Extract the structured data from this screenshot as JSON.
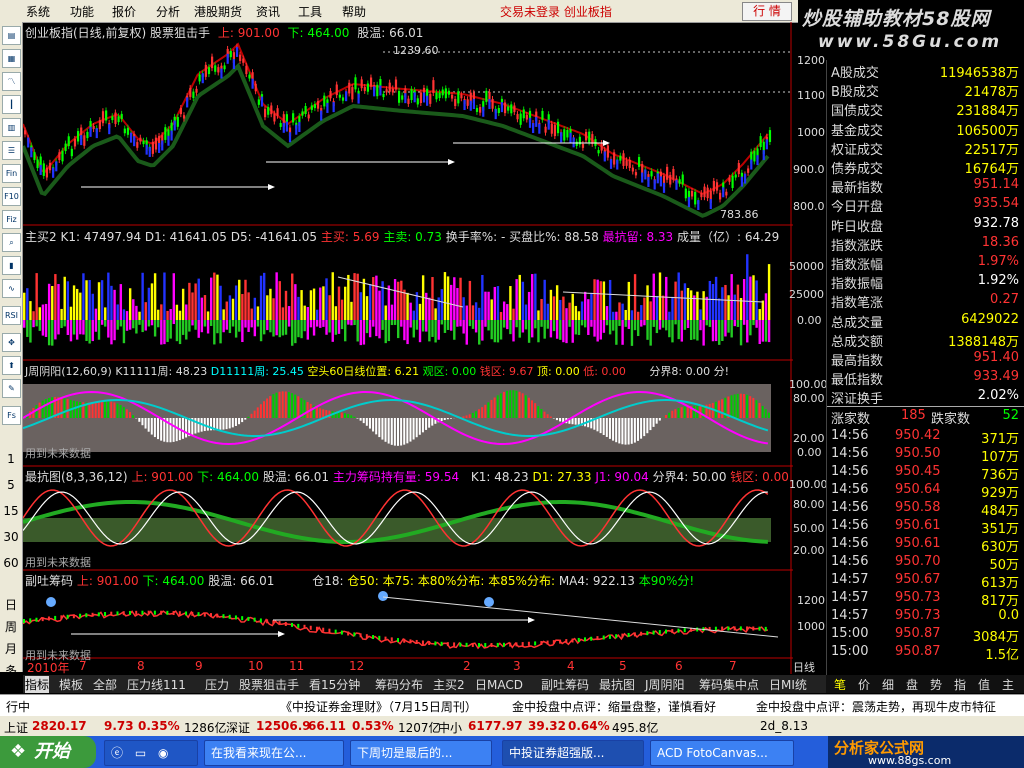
{
  "menu": {
    "items": [
      "系统",
      "功能",
      "报价",
      "分析",
      "港股期货",
      "资讯",
      "工具",
      "帮助"
    ],
    "status": "交易未登录  创业板指",
    "quote_button": "行 情"
  },
  "brand": {
    "line1": "炒股辅助教材58股网",
    "line2": "www.58Gu.com"
  },
  "toolbar": {
    "icons": [
      "Fin",
      "F10",
      "Fiz",
      "RSI"
    ],
    "periods": [
      "1",
      "5",
      "15",
      "30",
      "60",
      "日",
      "周",
      "月",
      "多"
    ]
  },
  "main_header": {
    "title": "创业板指(日线,前复权)",
    "indicator": "股票狙击手",
    "up": "上: 901.00",
    "down": "下: 464.00",
    "temp": "股温: 66.01",
    "hi_label": "1239.60",
    "lo_label": "783.86"
  },
  "y_main": [
    "1200",
    "1100",
    "1000",
    "900.0",
    "800.0"
  ],
  "panel2": {
    "title": "主买2",
    "k": "K1: 47497.94",
    "d1": "D1: 41641.05",
    "d5": "D5: -41641.05",
    "main_buy": "主买: 5.69",
    "main_sell": "主卖: 0.73",
    "turnover": "换手率%: -",
    "ratio": "买盘比%: 88.58",
    "lowest": "最抗留: 8.33",
    "volume": "成量（亿）: 64.29"
  },
  "y_p2": [
    "50000",
    "25000",
    "0.00"
  ],
  "panel3": {
    "title": "J周阴阳(12,60,9)",
    "k": "K11111周: 48.23",
    "d": "D11111周: 25.45",
    "line": "空头60日线位置: 6.21",
    "watch": "观区: 0.00",
    "buy": "钱区: 9.67",
    "top": "顶: 0.00",
    "low": "低: 0.00",
    "bound": "分界8: 0.00",
    "tail": "分!",
    "note": "用到未来数据"
  },
  "y_p3": [
    "100.00",
    "80.00",
    "20.00",
    "0.00"
  ],
  "panel4": {
    "title": "最抗图(8,3,36,12)",
    "up": "上: 901.00",
    "down": "下: 464.00",
    "temp": "股温: 66.01",
    "chip": "主力筹码持有量: 59.54",
    "k": "K1: 48.23",
    "d": "D1: 27.33",
    "j": "J1: 90.04",
    "bound": "分界4: 50.00",
    "buy": "钱区: 0.00",
    "note": "用到未来数据"
  },
  "y_p4": [
    "100.00",
    "80.00",
    "50.00",
    "20.00"
  ],
  "panel5": {
    "title": "副吐筹码",
    "up": "上: 901.00",
    "down": "下: 464.00",
    "temp": "股温: 66.01",
    "s1": "仓18:",
    "s2": "仓50:",
    "s3": "本75:",
    "s4": "本80%分布:",
    "s5": "本85%分布:",
    "ma": "MA4: 922.13",
    "s6": "本90%分!",
    "note": "用到未来数据"
  },
  "y_p5": [
    "1200",
    "1000"
  ],
  "x_axis": {
    "labels": [
      "2010年",
      "7",
      "8",
      "9",
      "10",
      "11",
      "12",
      "2",
      "3",
      "4",
      "5",
      "6",
      "7"
    ],
    "period": "日线"
  },
  "stats": [
    {
      "k": "A股成交",
      "v": "11946538万",
      "c": "#ff0"
    },
    {
      "k": "B股成交",
      "v": "21478万",
      "c": "#ff0"
    },
    {
      "k": "国债成交",
      "v": "231884万",
      "c": "#ff0"
    },
    {
      "k": "基金成交",
      "v": "106500万",
      "c": "#ff0"
    },
    {
      "k": "权证成交",
      "v": "22517万",
      "c": "#ff0"
    },
    {
      "k": "债券成交",
      "v": "16764万",
      "c": "#ff0"
    },
    {
      "k": "最新指数",
      "v": "951.14",
      "c": "#f33"
    },
    {
      "k": "今日开盘",
      "v": "935.54",
      "c": "#f33"
    },
    {
      "k": "昨日收盘",
      "v": "932.78",
      "c": "#fff"
    },
    {
      "k": "指数涨跌",
      "v": "18.36",
      "c": "#f33"
    },
    {
      "k": "指数涨幅",
      "v": "1.97%",
      "c": "#f33"
    },
    {
      "k": "指数振幅",
      "v": "1.92%",
      "c": "#fff"
    },
    {
      "k": "指数笔涨",
      "v": "0.27",
      "c": "#f33"
    },
    {
      "k": "总成交量",
      "v": "6429022",
      "c": "#ff0"
    },
    {
      "k": "总成交额",
      "v": "1388148万",
      "c": "#ff0"
    },
    {
      "k": "最高指数",
      "v": "951.40",
      "c": "#f33"
    },
    {
      "k": "最低指数",
      "v": "933.49",
      "c": "#f33"
    },
    {
      "k": "深证换手",
      "v": "2.02%",
      "c": "#fff"
    }
  ],
  "breadth": {
    "up_label": "涨家数",
    "up": "185",
    "down_label": "跌家数",
    "down": "52"
  },
  "ticks": [
    [
      "14:56",
      "950.42",
      "371万"
    ],
    [
      "14:56",
      "950.50",
      "107万"
    ],
    [
      "14:56",
      "950.45",
      "736万"
    ],
    [
      "14:56",
      "950.64",
      "929万"
    ],
    [
      "14:56",
      "950.58",
      "484万"
    ],
    [
      "14:56",
      "950.61",
      "351万"
    ],
    [
      "14:56",
      "950.61",
      "630万"
    ],
    [
      "14:56",
      "950.70",
      "50万"
    ],
    [
      "14:57",
      "950.67",
      "613万"
    ],
    [
      "14:57",
      "950.73",
      "817万"
    ],
    [
      "14:57",
      "950.73",
      "0.0"
    ],
    [
      "15:00",
      "950.87",
      "3084万"
    ],
    [
      "15:00",
      "950.87",
      "1.5亿"
    ]
  ],
  "tabs": [
    "指标",
    "模板",
    "全部",
    "压力线111",
    "压力",
    "股票狙击手",
    "看15分钟",
    "筹码分布",
    "主买2",
    "日MACD",
    "副吐筹码",
    "最抗图",
    "J周阴阳",
    "筹码集中点",
    "日MI统"
  ],
  "rtabs": [
    "笔",
    "价",
    "细",
    "盘",
    "势",
    "指",
    "值",
    "主"
  ],
  "news": [
    "行中",
    "《中投证券金理财》（7月15日周刊）",
    "金中投盘中点评：缩量盘整，谨慎看好",
    "金中投盘中点评：震荡走势，再现牛皮市特征"
  ],
  "index_bar": {
    "sh_label": "上证",
    "sh_val": "2820.17",
    "sh_chg": "9.73",
    "sh_pct": "0.35%",
    "sh_amt": "1286亿",
    "sz_label": "深证",
    "sz_val": "12506.9",
    "sz_chg": "66.11",
    "sz_pct": "0.53%",
    "sz_amt": "1207亿",
    "zx_label": "中小",
    "zx_val": "6177.97",
    "zx_chg": "39.32",
    "zx_pct": "0.64%",
    "zx_amt": "495.8亿",
    "date": "2d_8.13"
  },
  "taskbar": {
    "start": "开始",
    "tasks": [
      "在我看来现在公...",
      "下周切是最后的...",
      "中投证券超强版...",
      "ACD FotoCanvas..."
    ],
    "logo_big": "分析家公式网",
    "logo_small": "www.88gs.com"
  }
}
